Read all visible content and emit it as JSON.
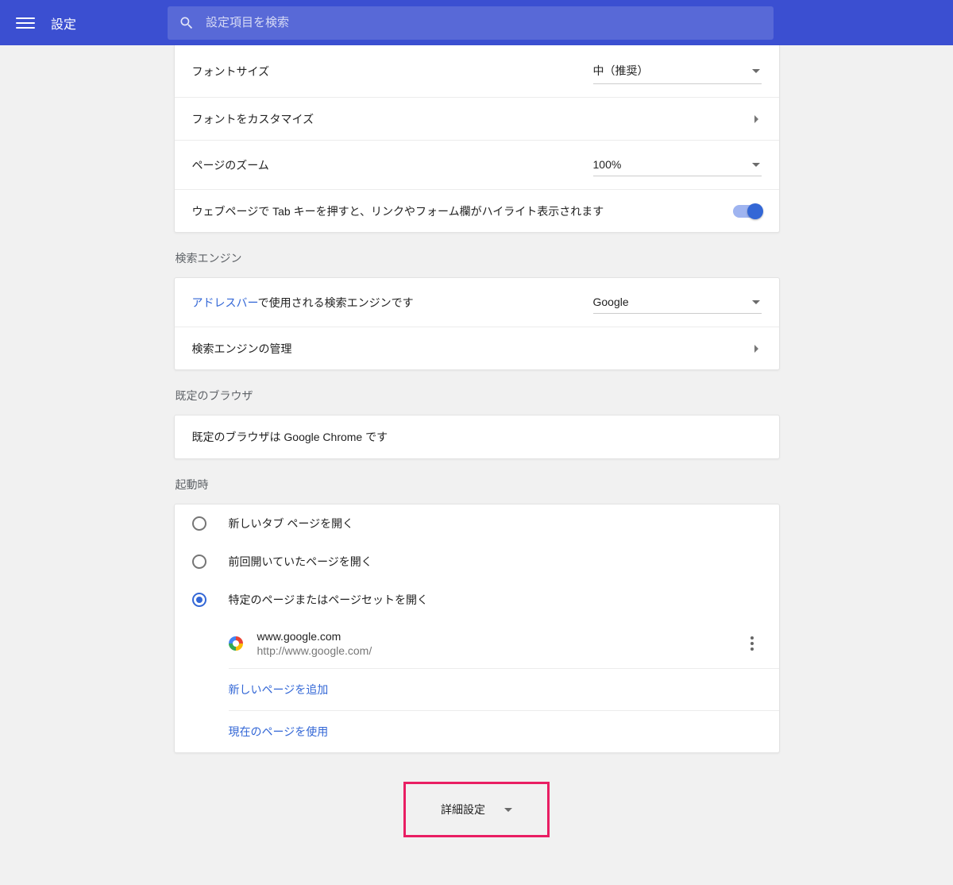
{
  "header": {
    "title": "設定",
    "search_placeholder": "設定項目を検索"
  },
  "appearance": {
    "font_size_label": "フォントサイズ",
    "font_size_value": "中（推奨）",
    "customize_fonts": "フォントをカスタマイズ",
    "page_zoom_label": "ページのズーム",
    "page_zoom_value": "100%",
    "tab_highlight": "ウェブページで Tab キーを押すと、リンクやフォーム欄がハイライト表示されます"
  },
  "search_engine": {
    "section_title": "検索エンジン",
    "addressbar_link": "アドレスバー",
    "addressbar_text": "で使用される検索エンジンです",
    "value": "Google",
    "manage": "検索エンジンの管理"
  },
  "default_browser": {
    "section_title": "既定のブラウザ",
    "text": "既定のブラウザは Google Chrome です"
  },
  "startup": {
    "section_title": "起動時",
    "opt_new_tab": "新しいタブ ページを開く",
    "opt_continue": "前回開いていたページを開く",
    "opt_specific": "特定のページまたはページセットを開く",
    "page": {
      "title": "www.google.com",
      "url": "http://www.google.com/"
    },
    "add_page": "新しいページを追加",
    "use_current": "現在のページを使用"
  },
  "advanced": "詳細設定"
}
